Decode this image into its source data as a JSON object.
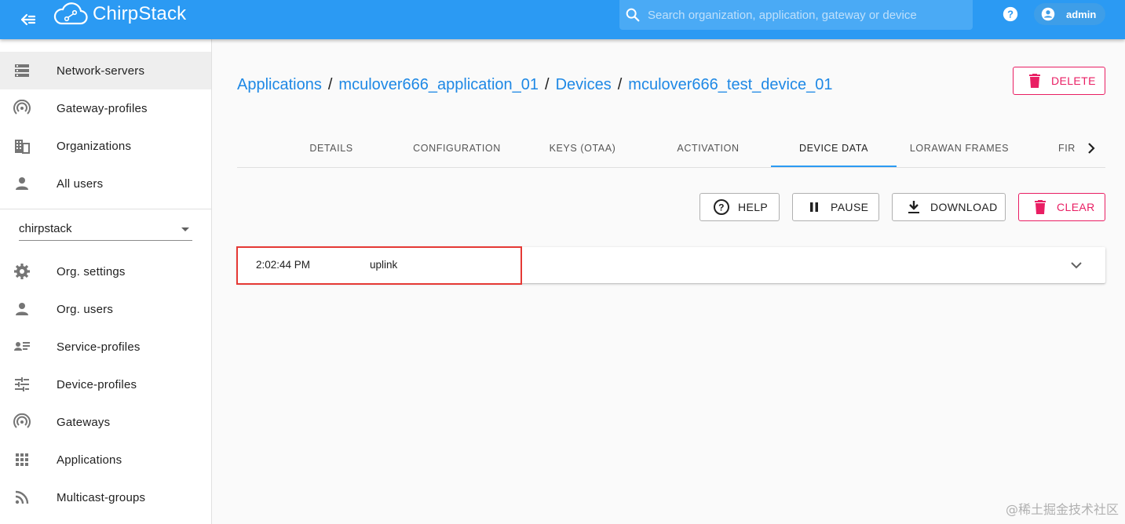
{
  "app": {
    "title": "ChirpStack"
  },
  "search": {
    "placeholder": "Search organization, application, gateway or device"
  },
  "user": {
    "name": "admin"
  },
  "sidebar": {
    "top_items": [
      {
        "label": "Network-servers",
        "icon": "server-icon",
        "active": true
      },
      {
        "label": "Gateway-profiles",
        "icon": "wifi-tethering-icon"
      },
      {
        "label": "Organizations",
        "icon": "building-icon"
      },
      {
        "label": "All users",
        "icon": "person-icon"
      }
    ],
    "org_select": {
      "value": "chirpstack"
    },
    "org_items": [
      {
        "label": "Org. settings",
        "icon": "gear-icon"
      },
      {
        "label": "Org. users",
        "icon": "person-icon"
      },
      {
        "label": "Service-profiles",
        "icon": "account-details-icon"
      },
      {
        "label": "Device-profiles",
        "icon": "tune-icon"
      },
      {
        "label": "Gateways",
        "icon": "wifi-tethering-icon"
      },
      {
        "label": "Applications",
        "icon": "apps-grid-icon"
      },
      {
        "label": "Multicast-groups",
        "icon": "rss-icon"
      }
    ]
  },
  "breadcrumb": {
    "items": [
      "Applications",
      "mculover666_application_01",
      "Devices",
      "mculover666_test_device_01"
    ],
    "separator": "/"
  },
  "header_actions": {
    "delete_label": "DELETE"
  },
  "tabs": {
    "items": [
      "DETAILS",
      "CONFIGURATION",
      "KEYS (OTAA)",
      "ACTIVATION",
      "DEVICE DATA",
      "LORAWAN FRAMES",
      "FIR"
    ],
    "active": "DEVICE DATA"
  },
  "toolbar": {
    "help_label": "HELP",
    "pause_label": "PAUSE",
    "download_label": "DOWNLOAD",
    "clear_label": "CLEAR"
  },
  "events": [
    {
      "time": "2:02:44 PM",
      "type": "uplink"
    }
  ],
  "watermark": "@稀土掘金技术社区",
  "colors": {
    "primary": "#2b9af3",
    "danger": "#e91e63",
    "link": "#1e88e5",
    "highlight": "#e53935"
  }
}
